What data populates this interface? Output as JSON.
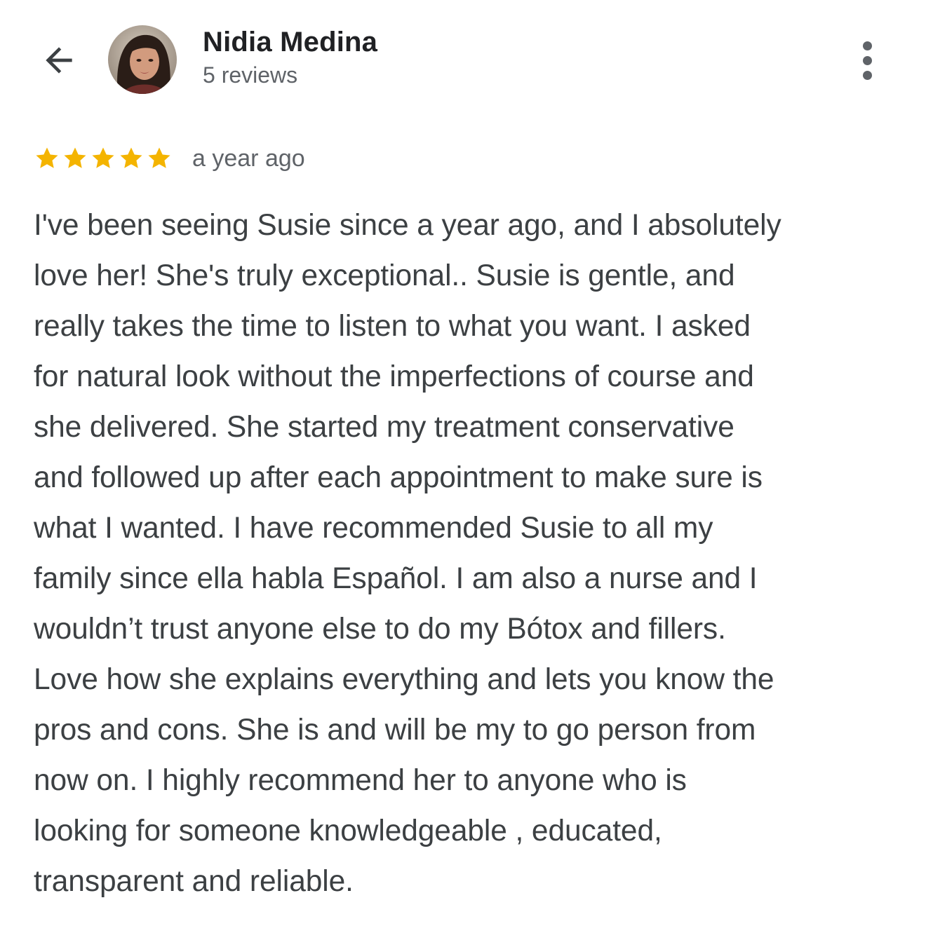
{
  "header": {
    "back_icon": "arrow-left-icon",
    "reviewer_name": "Nidia Medina",
    "reviewer_review_count": "5 reviews",
    "more_icon": "more-vertical-icon"
  },
  "review": {
    "rating": 5,
    "rating_max": 5,
    "star_color": "#f4b400",
    "time": "a year ago",
    "text_lines": [
      "I've been seeing Susie since a year ago, and I absolutely",
      "love her! She's truly exceptional.. Susie is gentle, and",
      "really takes the time to listen to what you want. I asked",
      "for natural look without the imperfections of course and",
      "she delivered. She started my treatment conservative",
      "and followed up after each appointment to make sure is",
      "what I wanted. I have recommended Susie to all my",
      "family since ella habla Español. I am also a nurse and I",
      "wouldn’t trust anyone else to do my Bótox and fillers.",
      "Love how she explains everything and lets you know the",
      "pros and cons. She is and will be my to go person from",
      "now on. I highly recommend her to anyone who is",
      "looking for someone knowledgeable , educated,",
      "transparent and reliable."
    ]
  }
}
